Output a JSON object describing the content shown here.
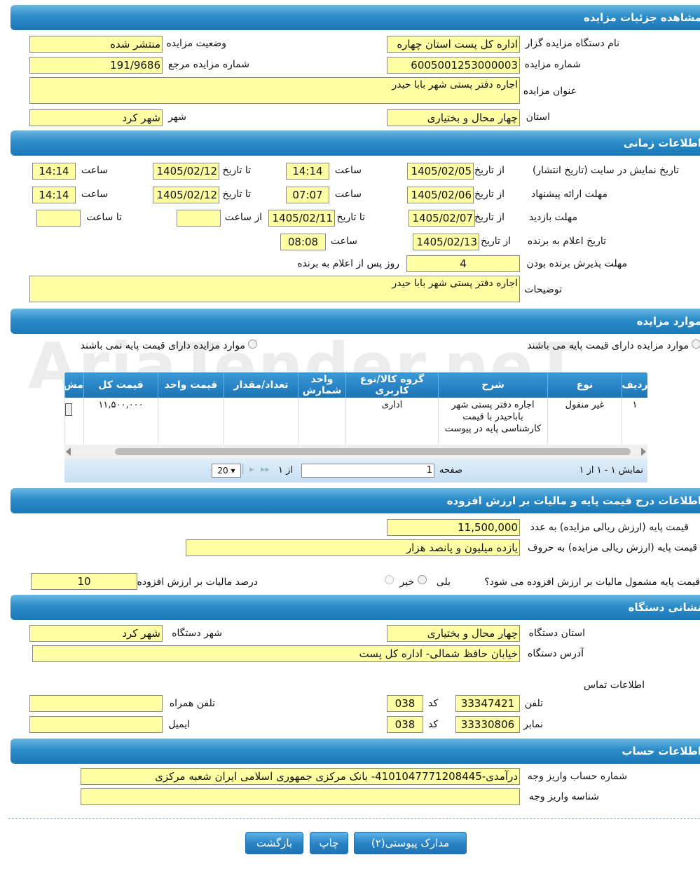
{
  "sections": {
    "details": "مشاهده جزئیات مزایده",
    "timing": "اطلاعات زمانی",
    "items": "موارد مزایده",
    "price": "اطلاعات درج قیمت پایه و مالیات بر ارزش افزوده",
    "address": "نشانی دستگاه",
    "account": "اطلاعات حساب"
  },
  "details": {
    "org_label": "نام دستگاه مزایده گزار",
    "org_value": "اداره کل پست استان چهاره",
    "status_label": "وضعیت مزایده",
    "status_value": "منتشر شده",
    "number_label": "شماره مزایده",
    "number_value": "6005001253000003",
    "ref_label": "شماره مزایده مرجع",
    "ref_value": "191/9686",
    "title_label": "عنوان مزایده",
    "title_value": "اجاره دفتر پستی شهر بابا حیدر",
    "province_label": "استان",
    "province_value": "چهار محال و بختیاری",
    "city_label": "شهر",
    "city_value": "شهر کرد"
  },
  "timing": {
    "from_date": "از تاریخ",
    "to_date": "تا تاریخ",
    "time": "ساعت",
    "from_time": "از ساعت",
    "to_time": "تا ساعت",
    "display_label": "تاریخ نمایش در سایت (تاریخ انتشار)",
    "display_from": "1405/02/05",
    "display_from_time": "14:14",
    "display_to": "1405/02/12",
    "display_to_time": "14:14",
    "offer_label": "مهلت ارائه پیشنهاد",
    "offer_from": "1405/02/06",
    "offer_from_time": "07:07",
    "offer_to": "1405/02/12",
    "offer_to_time": "14:14",
    "visit_label": "مهلت بازدید",
    "visit_from": "1405/02/07",
    "visit_to": "1405/02/11",
    "winner_label": "تاریخ اعلام به برنده",
    "winner_from": "1405/02/13",
    "winner_time": "08:08",
    "accept_label": "مهلت پذیرش برنده بودن",
    "accept_value": "4",
    "accept_suffix": "روز پس از اعلام به برنده",
    "desc_label": "توضیحات",
    "desc_value": "اجاره دفتر پستی شهر بابا حیدر"
  },
  "items": {
    "radio_with": "موارد مزایده دارای قیمت پایه می باشند",
    "radio_without": "موارد مزایده دارای قیمت پایه نمی باشند",
    "columns": [
      "ردیف",
      "نوع",
      "شرح",
      "گروه کالا/نوع کاربری",
      "واحد شمارش",
      "تعداد/مقدار",
      "قیمت واحد",
      "قیمت کل",
      "مش"
    ],
    "row": {
      "index": "۱",
      "type": "غیر منقول",
      "desc": "اجاره دفتر پستی شهر باباحیدر با قیمت کارشناسی پایه در پیوست",
      "group": "اداری",
      "unit": "",
      "qty": "",
      "unit_price": "",
      "total": "۱۱,۵۰۰,۰۰۰"
    },
    "pager": {
      "showing": "نمایش ۱ - ۱ از ۱",
      "page_label": "صفحه",
      "page_value": "1",
      "of": "از ۱",
      "page_size": "20"
    }
  },
  "price": {
    "base_num_label": "قیمت پایه (ارزش ریالی مزایده) به عدد",
    "base_num_value": "11,500,000",
    "base_words_label": "قیمت پایه (ارزش ریالی مزایده) به حروف",
    "base_words_value": "یازده میلیون و پانصد هزار",
    "tax_question": "قیمت پایه مشمول مالیات بر ارزش افزوده می شود؟",
    "yes": "بلی",
    "no": "خیر",
    "tax_percent_label": "درصد مالیات بر ارزش افزوده",
    "tax_percent_value": "10"
  },
  "address": {
    "province_label": "استان دستگاه",
    "province_value": "چهار محال و بختیاری",
    "city_label": "شهر دستگاه",
    "city_value": "شهر کرد",
    "address_label": "آدرس دستگاه",
    "address_value": "خیابان حافظ شمالی- اداره کل پست",
    "contact_label": "اطلاعات تماس",
    "phone_label": "تلفن",
    "phone_value": "33347421",
    "code_label": "کد",
    "phone_code": "038",
    "mobile_label": "تلفن همراه",
    "mobile_value": "",
    "fax_label": "نمابر",
    "fax_value": "33330806",
    "fax_code": "038",
    "email_label": "ایمیل",
    "email_value": ""
  },
  "account": {
    "account_label": "شماره حساب واریز وجه",
    "account_value": "درآمدی-4101047771208445- بانک مرکزی جمهوری اسلامی ایران شعبه مرکزی",
    "id_label": "شناسه واریز وجه",
    "id_value": ""
  },
  "buttons": {
    "attachments": "مدارک پیوستی(۲)",
    "print": "چاپ",
    "back": "بازگشت"
  },
  "watermark": "AriaTender.neT"
}
